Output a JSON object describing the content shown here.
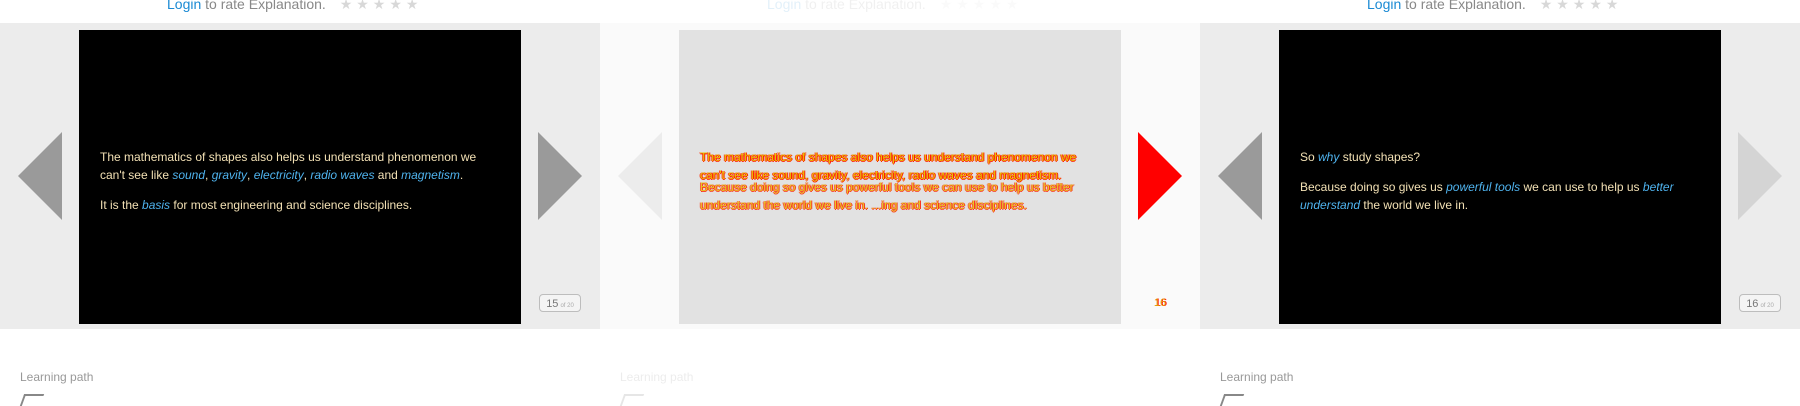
{
  "rate": {
    "login_label": "Login",
    "suffix": " to rate Explanation.",
    "stars": "★★★★★"
  },
  "frames": [
    {
      "page_number": "15",
      "page_unit": "of 20",
      "paragraphs": [
        {
          "segments": [
            {
              "t": "The mathematics of shapes also helps us understand phenomenon we can't see like "
            },
            {
              "t": "sound",
              "hl": true
            },
            {
              "t": ", "
            },
            {
              "t": "gravity",
              "hl": true
            },
            {
              "t": ", "
            },
            {
              "t": "electricity",
              "hl": true
            },
            {
              "t": ", "
            },
            {
              "t": "radio waves",
              "hl": true
            },
            {
              "t": " and "
            },
            {
              "t": "magnetism",
              "hl": true
            },
            {
              "t": "."
            }
          ]
        },
        {
          "segments": [
            {
              "t": "It is the "
            },
            {
              "t": "basis",
              "hl": true
            },
            {
              "t": " for most engineering and science disciplines."
            }
          ]
        }
      ]
    },
    {
      "page_number": "16",
      "page_unit": "of 20",
      "paragraphs": [
        {
          "segments": [
            {
              "t": "So "
            },
            {
              "t": "why",
              "hl": true
            },
            {
              "t": " study shapes?"
            }
          ]
        },
        {
          "segments": [
            {
              "t": "Because doing so gives us "
            },
            {
              "t": "powerful tools",
              "hl": true
            },
            {
              "t": " we can use to help us "
            },
            {
              "t": "better understand",
              "hl": true
            },
            {
              "t": " the world we live in."
            }
          ]
        }
      ]
    }
  ],
  "transition": {
    "line_a": "The mathematics of shapes also helps us understand phenomenon we can't see like sound, gravity, electricity, radio waves and magnetism.",
    "line_b": "Because doing so gives us powerful tools we can use to help us better understand the world we live in. ...ing and science disciplines.",
    "badge": "16"
  },
  "footer": {
    "learning_path_label": "Learning path"
  },
  "colors": {
    "slide_text": "#f2e0b4",
    "highlight": "#4fb3ee",
    "login_link": "#1a8ad4",
    "active_arrow": "#ff0000"
  },
  "icons": [
    "left-arrow-icon",
    "right-arrow-icon",
    "star-icon",
    "learning-path-icon"
  ]
}
